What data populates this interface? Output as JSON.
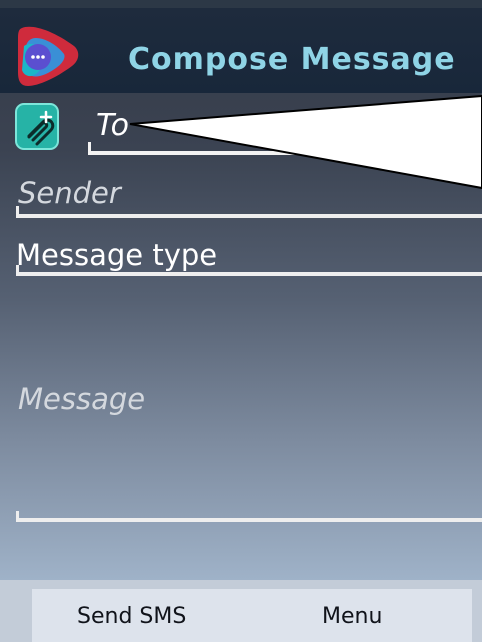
{
  "title_bar": {
    "title": "Compose Message"
  },
  "recipient": {
    "add_contact_icon": "paperclip-plus-icon",
    "placeholder": "To"
  },
  "fields": {
    "sender_placeholder": "Sender",
    "message_type_label": "Message type",
    "message_placeholder": "Message"
  },
  "softkeys": {
    "left": "Send SMS",
    "right": "Menu"
  },
  "colors": {
    "title_text": "#8fd4e6",
    "title_bar": "#1e2b3d",
    "contact_button": "#26b3a6",
    "softkey_bar": "#dde3ec"
  }
}
